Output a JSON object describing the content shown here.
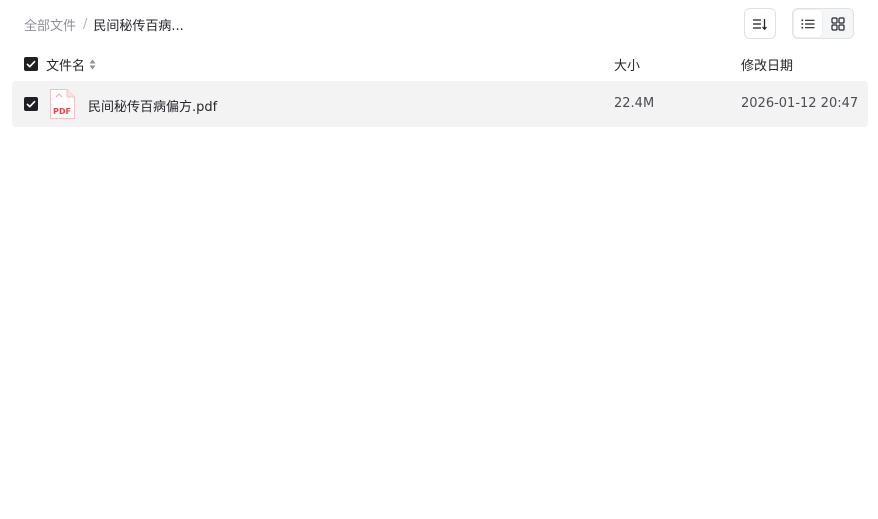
{
  "breadcrumb": {
    "root": "全部文件",
    "separator": "/",
    "current": "民间秘传百病..."
  },
  "toolbar": {
    "sort_icon": "sort-descending-icon",
    "list_view_icon": "list-view-icon",
    "grid_view_icon": "grid-view-icon",
    "active_view": "list"
  },
  "table": {
    "headers": {
      "name": "文件名",
      "size": "大小",
      "modified": "修改日期"
    },
    "rows": [
      {
        "checked": true,
        "icon": "pdf-file-icon",
        "icon_label": "PDF",
        "name": "民间秘传百病偏方.pdf",
        "size": "22.4M",
        "modified": "2026-01-12 20:47"
      }
    ]
  },
  "colors": {
    "text_primary": "#25262b",
    "text_muted": "#8e9099",
    "row_selected_bg": "#f3f3f4",
    "checkbox_fill": "#1f2024",
    "pdf_red": "#e5484d"
  }
}
